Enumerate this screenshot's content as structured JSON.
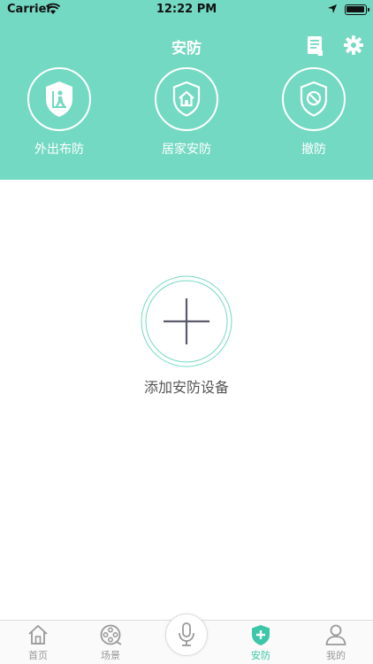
{
  "status_bar": {
    "carrier": "Carrier",
    "time": "12:22 PM"
  },
  "header": {
    "title": "安防"
  },
  "modes": [
    {
      "label": "外出布防",
      "icon": "shield-person-icon"
    },
    {
      "label": "居家安防",
      "icon": "shield-home-icon"
    },
    {
      "label": "撤防",
      "icon": "shield-disarm-icon"
    }
  ],
  "main": {
    "add_label": "添加安防设备"
  },
  "tabbar": {
    "items": [
      {
        "label": "首页",
        "icon": "home-icon"
      },
      {
        "label": "场景",
        "icon": "film-reel-icon"
      },
      {
        "label": "",
        "icon": "microphone-icon"
      },
      {
        "label": "安防",
        "icon": "shield-plus-icon",
        "active": true
      },
      {
        "label": "我的",
        "icon": "user-icon"
      }
    ]
  },
  "colors": {
    "header_bg": "#74d9c3",
    "accent": "#3dc7a8"
  }
}
